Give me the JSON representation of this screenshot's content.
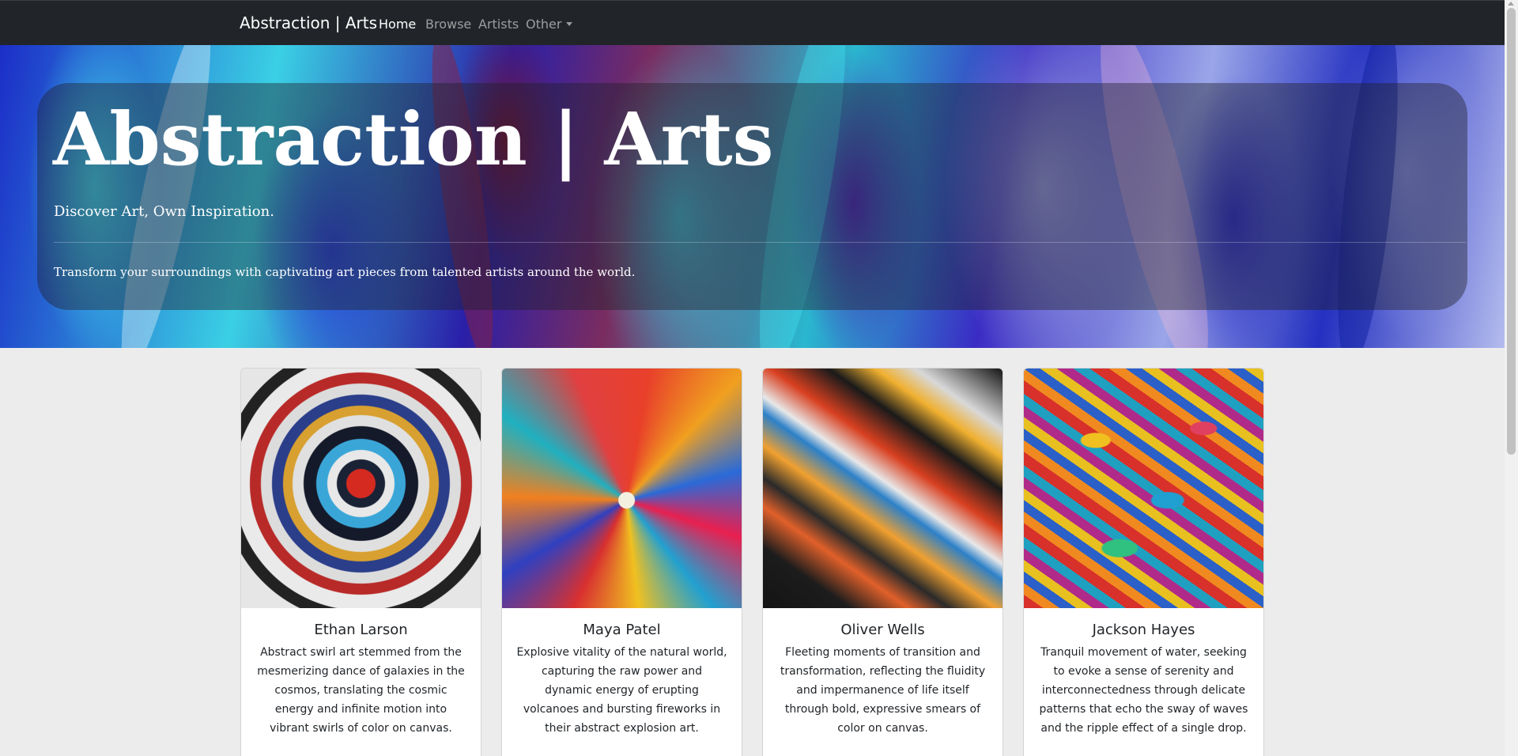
{
  "navbar": {
    "brand": "Abstraction | Arts",
    "items": [
      {
        "label": "Home",
        "active": true
      },
      {
        "label": "Browse",
        "active": false
      },
      {
        "label": "Artists",
        "active": false
      },
      {
        "label": "Other",
        "active": false,
        "dropdown": true
      }
    ]
  },
  "hero": {
    "title": "Abstraction | Arts",
    "subtitle": "Discover Art, Own Inspiration.",
    "description": "Transform your surroundings with captivating art pieces from talented artists around the world."
  },
  "artists": [
    {
      "name": "Ethan Larson",
      "description": "Abstract swirl art stemmed from the mesmerizing dance of galaxies in the cosmos, translating the cosmic energy and infinite motion into vibrant swirls of color on canvas."
    },
    {
      "name": "Maya Patel",
      "description": "Explosive vitality of the natural world, capturing the raw power and dynamic energy of erupting volcanoes and bursting fireworks in their abstract explosion art."
    },
    {
      "name": "Oliver Wells",
      "description": "Fleeting moments of transition and transformation, reflecting the fluidity and impermanence of life itself through bold, expressive smears of color on canvas."
    },
    {
      "name": "Jackson Hayes",
      "description": "Tranquil movement of water, seeking to evoke a sense of serenity and interconnectedness through delicate patterns that echo the sway of waves and the ripple effect of a single drop."
    }
  ],
  "colors": {
    "navbar_bg": "#212529",
    "nav_active": "#ffffff",
    "nav_inactive": "rgba(255,255,255,0.55)",
    "page_bg": "#ececec"
  }
}
